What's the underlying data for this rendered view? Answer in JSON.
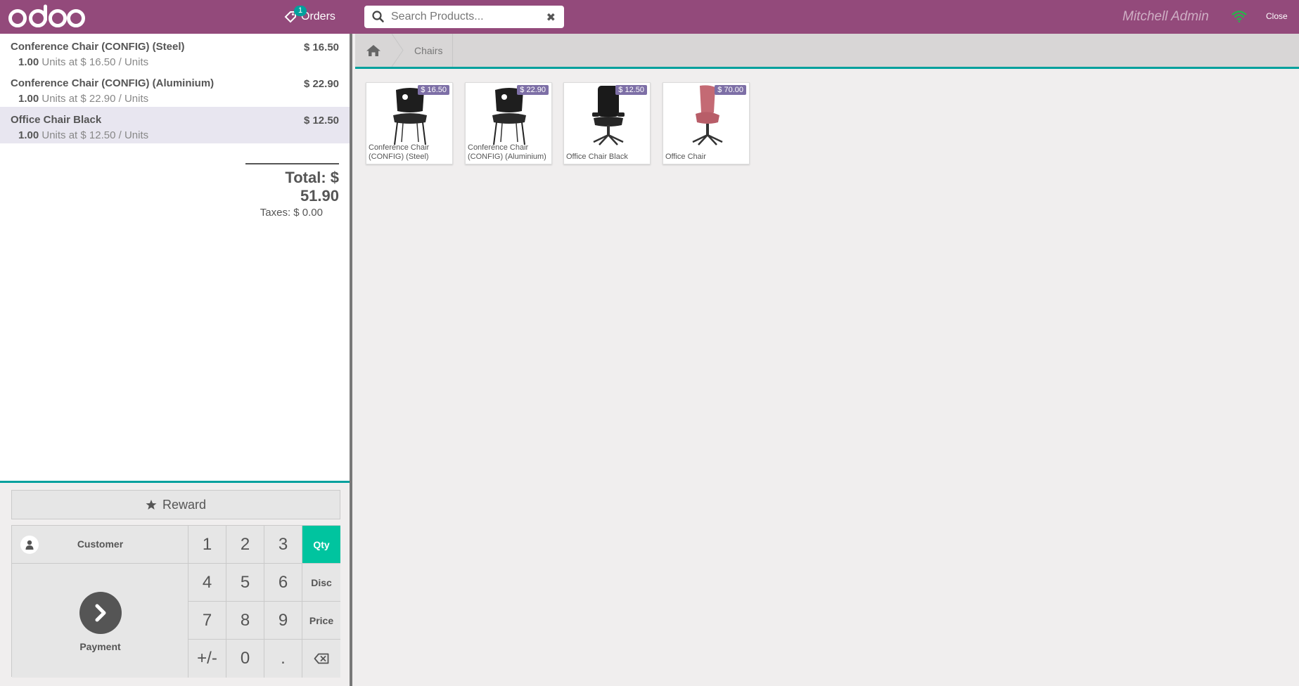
{
  "header": {
    "logo_text": "odoo",
    "orders_label": "Orders",
    "orders_count": "1",
    "search_placeholder": "Search Products...",
    "user_name": "Mitchell Admin",
    "close_label": "Close",
    "brand_color": "#934a7b",
    "accent_color": "#00a09d"
  },
  "order": {
    "lines": [
      {
        "name": "Conference Chair (CONFIG) (Steel)",
        "price": "$ 16.50",
        "qty": "1.00",
        "unit_info": "Units at $ 16.50 / Units"
      },
      {
        "name": "Conference Chair (CONFIG) (Aluminium)",
        "price": "$ 22.90",
        "qty": "1.00",
        "unit_info": "Units at $ 22.90 / Units"
      },
      {
        "name": "Office Chair Black",
        "price": "$ 12.50",
        "qty": "1.00",
        "unit_info": "Units at $ 12.50 / Units",
        "selected": true
      }
    ],
    "total": "Total: $ 51.90",
    "taxes": "Taxes: $ 0.00"
  },
  "controls": {
    "reward_label": "Reward",
    "customer_label": "Customer",
    "payment_label": "Payment",
    "keys": {
      "k1": "1",
      "k2": "2",
      "k3": "3",
      "k4": "4",
      "k5": "5",
      "k6": "6",
      "k7": "7",
      "k8": "8",
      "k9": "9",
      "sign": "+/-",
      "k0": "0",
      "dot": "."
    },
    "modes": {
      "qty": "Qty",
      "disc": "Disc",
      "price": "Price"
    },
    "active_mode": "Qty"
  },
  "breadcrumb": {
    "category": "Chairs"
  },
  "products": [
    {
      "name": "Conference Chair (CONFIG) (Steel)",
      "price": "$ 16.50",
      "icon": "conference-chair"
    },
    {
      "name": "Conference Chair (CONFIG) (Aluminium)",
      "price": "$ 22.90",
      "icon": "conference-chair"
    },
    {
      "name": "Office Chair Black",
      "price": "$ 12.50",
      "icon": "office-chair-black"
    },
    {
      "name": "Office Chair",
      "price": "$ 70.00",
      "icon": "office-chair-pink"
    }
  ]
}
